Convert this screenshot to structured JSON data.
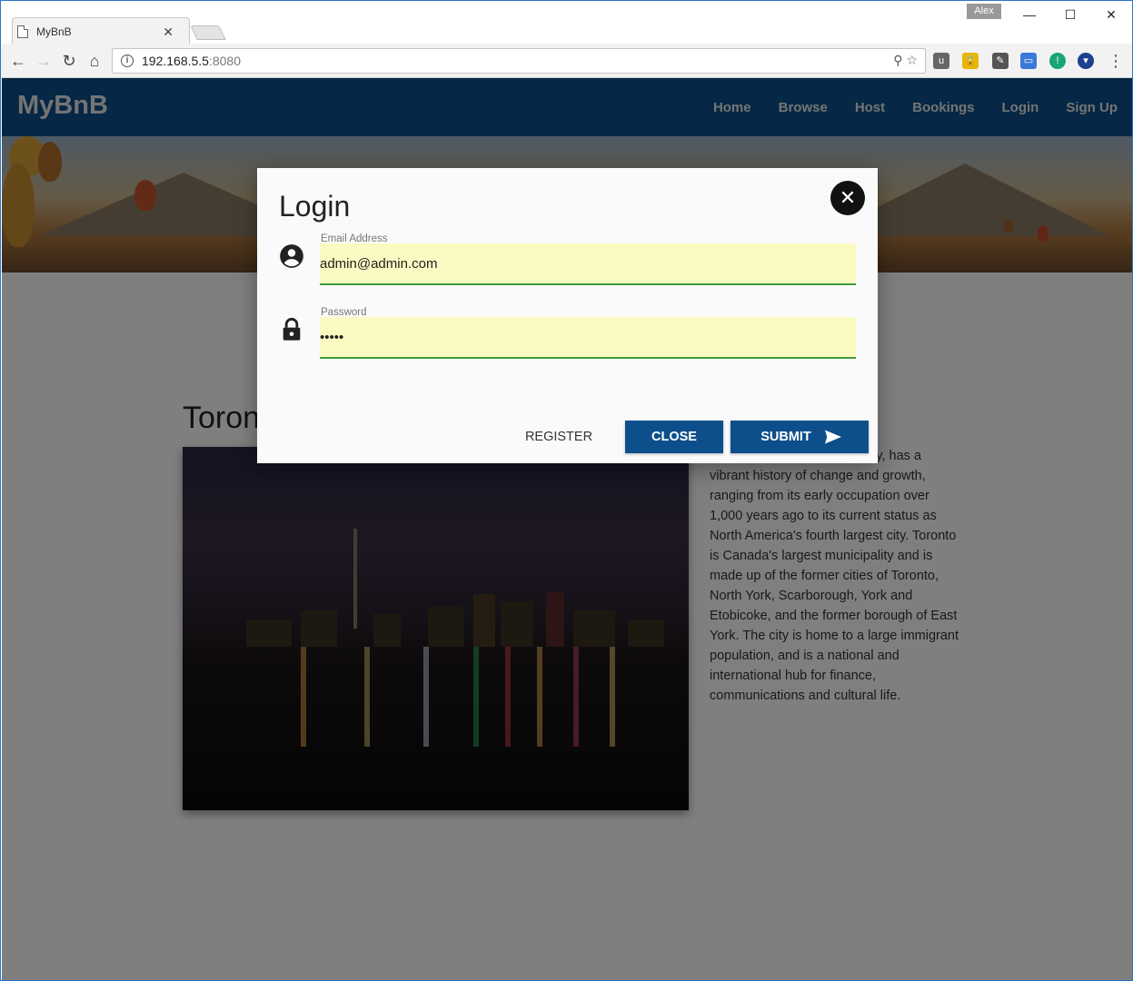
{
  "browser": {
    "tab_title": "MyBnB",
    "tab_close": "✕",
    "profile_name": "Alex",
    "url_host": "192.168.5.5",
    "url_port": ":8080",
    "minimize": "—",
    "maximize": "☐",
    "close": "✕"
  },
  "app": {
    "brand": "MyBnB",
    "nav": [
      "Home",
      "Browse",
      "Host",
      "Bookings",
      "Login",
      "Sign Up"
    ],
    "accent_color": "#0d4f8b"
  },
  "content": {
    "title": "Toronto",
    "description": "Toronto, Canada's largest city, has a vibrant history of change and growth, ranging from its early occupation over 1,000 years ago to its current status as North America's fourth largest city. Toronto is Canada's largest municipality and is made up of the former cities of Toronto, North York, Scarborough, York and Etobicoke, and the former borough of East York. The city is home to a large immigrant population, and is a national and international hub for finance, communications and cultural life."
  },
  "login_modal": {
    "title": "Login",
    "email_label": "Email Address",
    "email_value": "admin@admin.com",
    "password_label": "Password",
    "password_value": "•••••",
    "register_label": "REGISTER",
    "close_label": "CLOSE",
    "submit_label": "SUBMIT",
    "field_fill_color": "#fafac2",
    "field_underline_color": "#3e9b3e"
  }
}
